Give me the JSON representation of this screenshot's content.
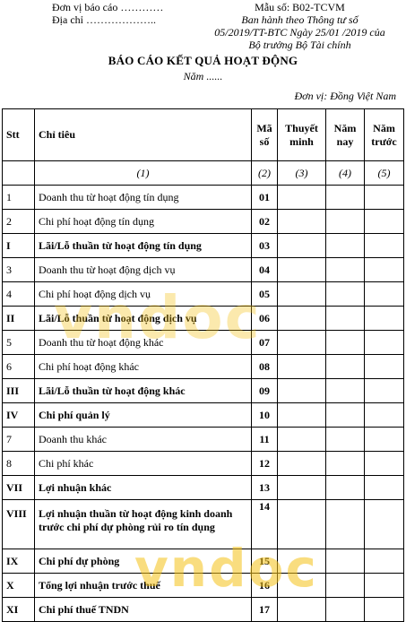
{
  "header_left": {
    "reporting_unit": "Đơn vị báo cáo …………",
    "address": "Địa chỉ ……………….."
  },
  "header_right": {
    "form_no": "Mẫu số: B02-TCVM",
    "issued_line1": "Ban hành theo Thông tư số",
    "issued_line2": "05/2019/TT-BTC Ngày 25/01 /2019 của",
    "issued_line3": "Bộ trưởng Bộ Tài chính"
  },
  "title": "BÁO CÁO KẾT QUẢ HOẠT ĐỘNG",
  "year": "Năm ......",
  "currency_unit": "Đơn vị: Đồng Việt Nam",
  "table": {
    "headers": {
      "stt": "Stt",
      "indicator": "Chỉ tiêu",
      "code_line1": "Mã",
      "code_line2": "số",
      "note_line1": "Thuyết",
      "note_line2": "minh",
      "this_year_line1": "Năm",
      "this_year_line2": "nay",
      "prev_year_line1": "Năm",
      "prev_year_line2": "trước"
    },
    "column_numbers": [
      "(1)",
      "(2)",
      "(3)",
      "(4)",
      "(5)"
    ],
    "rows": [
      {
        "stt": "1",
        "label": "Doanh thu từ hoạt động tín dụng",
        "code": "01",
        "bold": false
      },
      {
        "stt": "2",
        "label": "Chi phí hoạt động tín dụng",
        "code": "02",
        "bold": false
      },
      {
        "stt": "I",
        "label": "Lãi/Lỗ thuần từ hoạt động tín dụng",
        "code": "03",
        "bold": true
      },
      {
        "stt": "3",
        "label": "Doanh thu từ hoạt động dịch vụ",
        "code": "04",
        "bold": false
      },
      {
        "stt": "4",
        "label": "Chi phí hoạt động dịch vụ",
        "code": "05",
        "bold": false
      },
      {
        "stt": "II",
        "label": "Lãi/Lỗ thuần từ hoạt động dịch vụ",
        "code": "06",
        "bold": true
      },
      {
        "stt": "5",
        "label": "Doanh thu từ hoạt động khác",
        "code": "07",
        "bold": false
      },
      {
        "stt": "6",
        "label": "Chi phí hoạt động khác",
        "code": "08",
        "bold": false
      },
      {
        "stt": "III",
        "label": "Lãi/Lỗ thuần từ hoạt động khác",
        "code": "09",
        "bold": true
      },
      {
        "stt": "IV",
        "label": "Chi phí quản lý",
        "code": "10",
        "bold": true
      },
      {
        "stt": "7",
        "label": "Doanh thu khác",
        "code": "11",
        "bold": false
      },
      {
        "stt": "8",
        "label": "Chi phí khác",
        "code": "12",
        "bold": false
      },
      {
        "stt": "VII",
        "label": "Lợi nhuận khác",
        "code": "13",
        "bold": true
      },
      {
        "stt": "VIII",
        "label": "Lợi nhuận thuần từ hoạt động kinh doanh trước chi phí dự phòng rủi ro tín dụng",
        "code": "14",
        "bold": true,
        "tall": true
      },
      {
        "stt": "IX",
        "label": "Chi phí dự phòng",
        "code": "15",
        "bold": true
      },
      {
        "stt": "X",
        "label": "Tổng lợi nhuận trước thuế",
        "code": "16",
        "bold": true
      },
      {
        "stt": "XI",
        "label": "Chi phí thuế TNDN",
        "code": "17",
        "bold": true
      }
    ]
  },
  "watermark": "vndoc",
  "colors": {
    "watermark": "#f5c218"
  }
}
